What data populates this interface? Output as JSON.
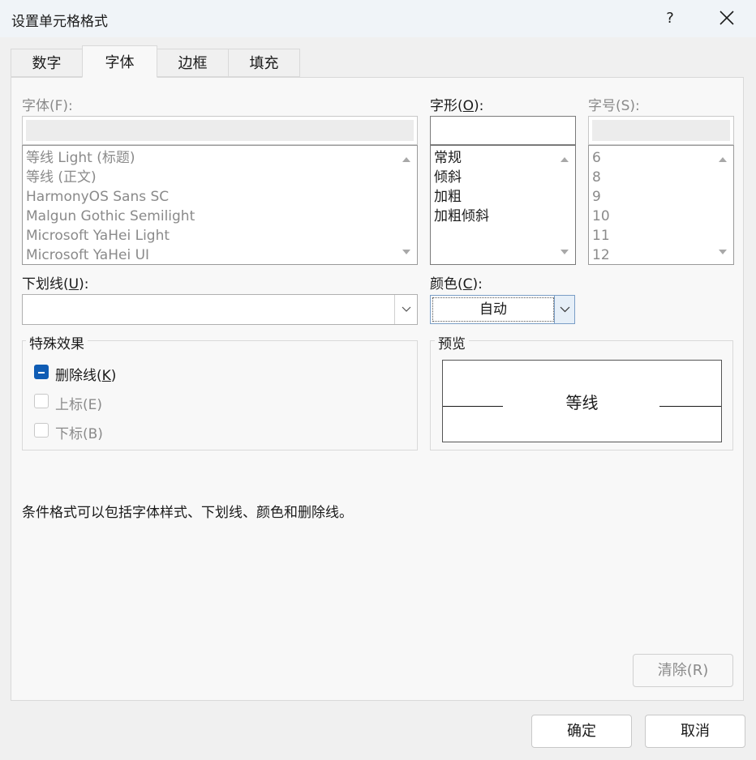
{
  "window": {
    "title": "设置单元格格式",
    "help": "?"
  },
  "tabs": [
    {
      "label": "数字"
    },
    {
      "label": "字体"
    },
    {
      "label": "边框"
    },
    {
      "label": "填充"
    }
  ],
  "font": {
    "label_main": "字体(F):",
    "items": [
      "等线 Light (标题)",
      "等线 (正文)",
      "HarmonyOS Sans SC",
      "Malgun Gothic Semilight",
      "Microsoft YaHei Light",
      "Microsoft YaHei UI"
    ]
  },
  "style": {
    "label_pre": "字形(",
    "label_key": "O",
    "label_post": "):",
    "items": [
      "常规",
      "倾斜",
      "加粗",
      "加粗倾斜"
    ]
  },
  "size": {
    "label_main": "字号(S):",
    "items": [
      "6",
      "8",
      "9",
      "10",
      "11",
      "12"
    ]
  },
  "underline": {
    "label_pre": "下划线(",
    "label_key": "U",
    "label_post": "):",
    "value": ""
  },
  "color": {
    "label_pre": "颜色(",
    "label_key": "C",
    "label_post": "):",
    "value": "自动"
  },
  "effects": {
    "title": "特殊效果",
    "strike_pre": "删除线(",
    "strike_key": "K",
    "strike_post": ")",
    "superscript": "上标(E)",
    "subscript": "下标(B)"
  },
  "preview": {
    "title": "预览",
    "sample": "等线"
  },
  "note": "条件格式可以包括字体样式、下划线、颜色和删除线。",
  "buttons": {
    "clear": "清除(R)",
    "ok": "确定",
    "cancel": "取消"
  },
  "colors": {
    "accent": "#0f5cb4",
    "panel": "#f8f8f8",
    "window": "#f0f0f0"
  }
}
